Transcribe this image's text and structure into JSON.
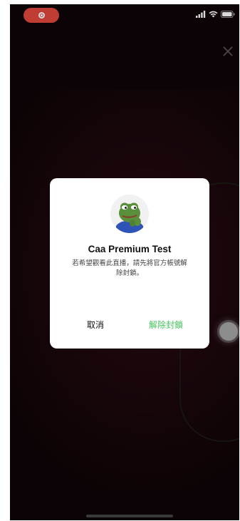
{
  "dialog": {
    "title": "Caa Premium Test",
    "message": "若希望觀看此直播，請先將官方帳號解除封鎖。",
    "cancel_label": "取消",
    "unblock_label": "解除封鎖"
  },
  "icons": {
    "record": "record-icon",
    "signal": "cellular-signal-icon",
    "wifi": "wifi-icon",
    "battery": "battery-icon",
    "close": "close-icon",
    "avatar": "frog-avatar-icon"
  },
  "colors": {
    "record_pill": "#e2483e",
    "accent_green": "#45c35d",
    "background": "#0e0406"
  }
}
